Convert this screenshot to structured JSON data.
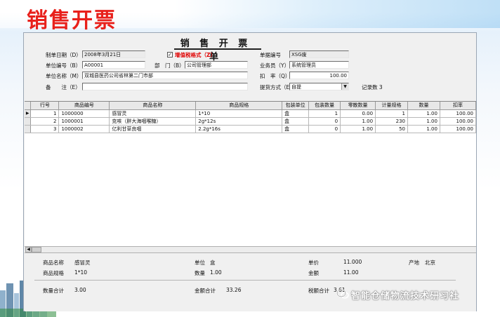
{
  "slide": {
    "title": "销售开票",
    "watermark": "智能仓储物流技术研习社"
  },
  "form": {
    "doc_title": "销 售 开 票 单",
    "invoice_date_label": "制单日期（D）",
    "invoice_date_value": "2008年3月21日",
    "tax_mode_checked": "✓",
    "tax_mode_label": "增值税格式（Z）",
    "doc_no_label": "单据编号",
    "doc_no_value": "XSG废",
    "unit_code_label": "单位编号（B）",
    "unit_code_value": "A00001",
    "dept_label": "部　门（B）",
    "dept_value": "公司管理部",
    "salesman_label": "业务员（Y）",
    "salesman_value": "系统管理员",
    "unit_name_label": "单位名称（M）",
    "unit_name_value": "双城县医药公司省林第二门市部",
    "discount_label": "扣　率（Q）",
    "discount_value": "100.00",
    "remark_label": "备　　注（E）",
    "remark_value": "",
    "settle_label": "提货方式（E）",
    "settle_value": "自提",
    "record_count": "记录数 3"
  },
  "grid": {
    "columns": [
      "行号",
      "商品编号",
      "商品名称",
      "商品规格",
      "包装单位",
      "包装数量",
      "零散数量",
      "计量规格",
      "数量",
      "扣率"
    ],
    "rows": [
      {
        "no": "1",
        "code": "1000000",
        "name": "感冒灵",
        "spec": "1*10",
        "unit": "盒",
        "pack_qty": "1",
        "loose_qty": "0.00",
        "measure": "1",
        "qty": "1.00",
        "rate": "100.00"
      },
      {
        "no": "2",
        "code": "1000001",
        "name": "克咳（胖大海咽喉糖）",
        "spec": "2g*12s",
        "unit": "盒",
        "pack_qty": "0",
        "loose_qty": "1.00",
        "measure": "230",
        "qty": "1.00",
        "rate": "100.00"
      },
      {
        "no": "3",
        "code": "1000002",
        "name": "亿利甘草良咽",
        "spec": "2.2g*16s",
        "unit": "盒",
        "pack_qty": "0",
        "loose_qty": "1.00",
        "measure": "50",
        "qty": "1.00",
        "rate": "100.00"
      }
    ]
  },
  "details": {
    "item_name_label": "商品名称",
    "item_name_value": "感冒灵",
    "item_unit_label": "单位",
    "item_unit_value": "盒",
    "price_label": "单价",
    "price_value": "11.000",
    "origin_label": "产地",
    "origin_value": "北京",
    "item_spec_label": "商品规格",
    "item_spec_value": "1*10",
    "qty_label": "数量",
    "qty_value": "1.00",
    "amount_label": "金额",
    "amount_value": "11.00",
    "qty_total_label": "数量合计",
    "qty_total_value": "3.00",
    "amount_total_label": "金额合计",
    "amount_total_value": "33.26",
    "tax_total_label": "税额合计",
    "tax_total_value": "3.61"
  },
  "colors": {
    "title_red": "#e8201b",
    "window_bg": "#f0f0f0"
  }
}
